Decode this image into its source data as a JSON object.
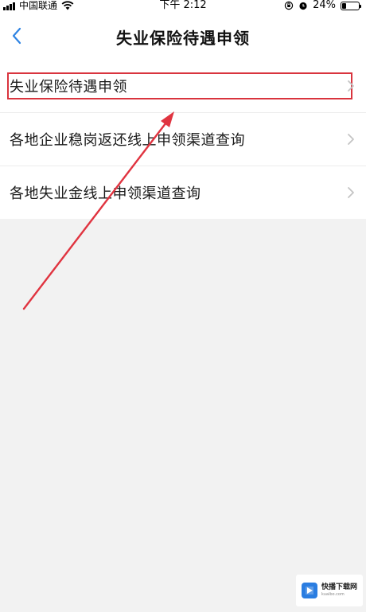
{
  "status_bar": {
    "carrier": "中国联通",
    "time": "下午 2:12",
    "battery_percent": "24%",
    "battery_level": 0.24,
    "icons": [
      "signal-icon",
      "wifi-icon",
      "rotation-lock-icon",
      "alarm-icon",
      "battery-icon"
    ]
  },
  "nav": {
    "title": "失业保险待遇申领",
    "back_icon": "chevron-left-icon"
  },
  "list": {
    "items": [
      {
        "label": "失业保险待遇申领",
        "icon": "chevron-right-icon",
        "highlighted": true
      },
      {
        "label": "各地企业稳岗返还线上申领渠道查询",
        "icon": "chevron-right-icon"
      },
      {
        "label": "各地失业金线上申领渠道查询",
        "icon": "chevron-right-icon"
      }
    ]
  },
  "annotation": {
    "highlight_color": "#d9343e",
    "arrow_color": "#e03440"
  },
  "watermark": {
    "name": "快播下载网",
    "url": "kuaibo.com",
    "accent": "#2a7de1"
  }
}
